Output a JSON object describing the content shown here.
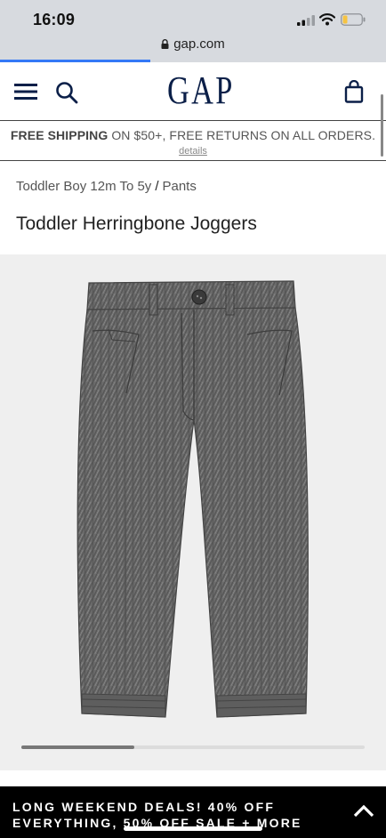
{
  "status_bar": {
    "time": "16:09",
    "battery_color": "#f6c342"
  },
  "browser": {
    "url": "gap.com",
    "load_progress": 0.39,
    "progress_color": "#3478f6"
  },
  "header": {
    "brand": "GAP",
    "icons": {
      "menu": "hamburger-menu-icon",
      "search": "search-icon",
      "bag": "shopping-bag-icon"
    },
    "brand_color": "#0b1f48"
  },
  "shipping_banner": {
    "bold": "FREE SHIPPING",
    "rest": " ON $50+, FREE RETURNS ON ALL ORDERS.",
    "details_link": "details"
  },
  "breadcrumb": {
    "level1": "Toddler Boy 12m To 5y",
    "separator": "/",
    "level2": "Pants"
  },
  "product": {
    "title": "Toddler Herringbone Joggers",
    "image": "grey-herringbone-jogger-pants",
    "carousel_position": 0.33
  },
  "promo_banner": {
    "line1": "LONG WEEKEND DEALS! 40% OFF",
    "line2": "EVERYTHING, 50% OFF SALE + MORE",
    "expand_icon": "chevron-up-icon"
  }
}
